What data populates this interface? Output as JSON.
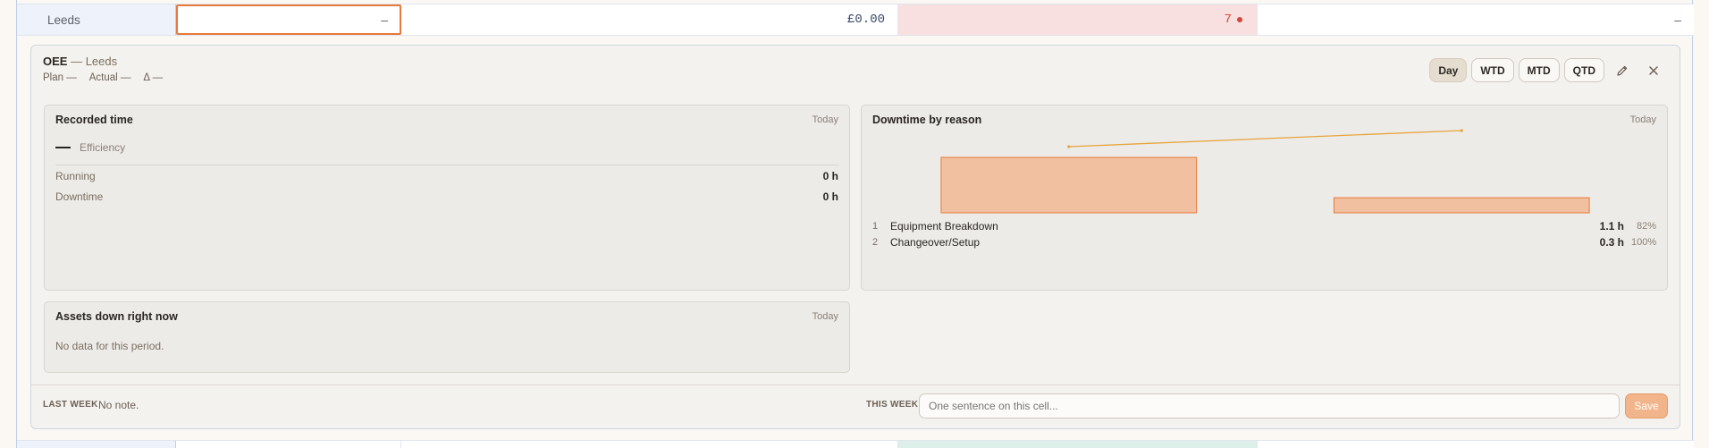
{
  "row": {
    "name": "Leeds",
    "plan_value": "–",
    "money": "£0.00",
    "count": "7",
    "last": "–"
  },
  "panel": {
    "title_bold": "OEE",
    "title_sep": " — ",
    "title_site": "Leeds",
    "meta": {
      "plan": "Plan —",
      "actual": "Actual —",
      "delta": "Δ —"
    },
    "periods": [
      "Day",
      "WTD",
      "MTD",
      "QTD"
    ],
    "active_period": "Day"
  },
  "recorded_time": {
    "title": "Recorded time",
    "tag": "Today",
    "efficiency_label": "Efficiency",
    "rows": [
      {
        "label": "Running",
        "value": "0 h"
      },
      {
        "label": "Downtime",
        "value": "0 h"
      }
    ]
  },
  "downtime": {
    "title": "Downtime by reason",
    "tag": "Today",
    "reasons": [
      {
        "rank": "1",
        "name": "Equipment Breakdown",
        "hours": "1.1 h",
        "pct": "82%"
      },
      {
        "rank": "2",
        "name": "Changeover/Setup",
        "hours": "0.3 h",
        "pct": "100%"
      }
    ]
  },
  "chart_data": {
    "type": "bar",
    "categories": [
      "Equipment Breakdown",
      "Changeover/Setup"
    ],
    "values": [
      1.1,
      0.3
    ],
    "cumulative_pct": [
      82,
      100
    ],
    "title": "Downtime by reason",
    "xlabel": "",
    "ylabel": "",
    "bar_color": "#f0c0a0",
    "line_color": "#e8a43a"
  },
  "assets": {
    "title": "Assets down right now",
    "tag": "Today",
    "empty": "No data for this period."
  },
  "notes": {
    "last_week_label": "LAST WEEK",
    "last_week_value": "No note.",
    "this_week_label": "THIS WEEK",
    "placeholder": "One sentence on this cell...",
    "save": "Save"
  },
  "colors": {
    "accent": "#e8793a",
    "alert": "#d2473b"
  }
}
